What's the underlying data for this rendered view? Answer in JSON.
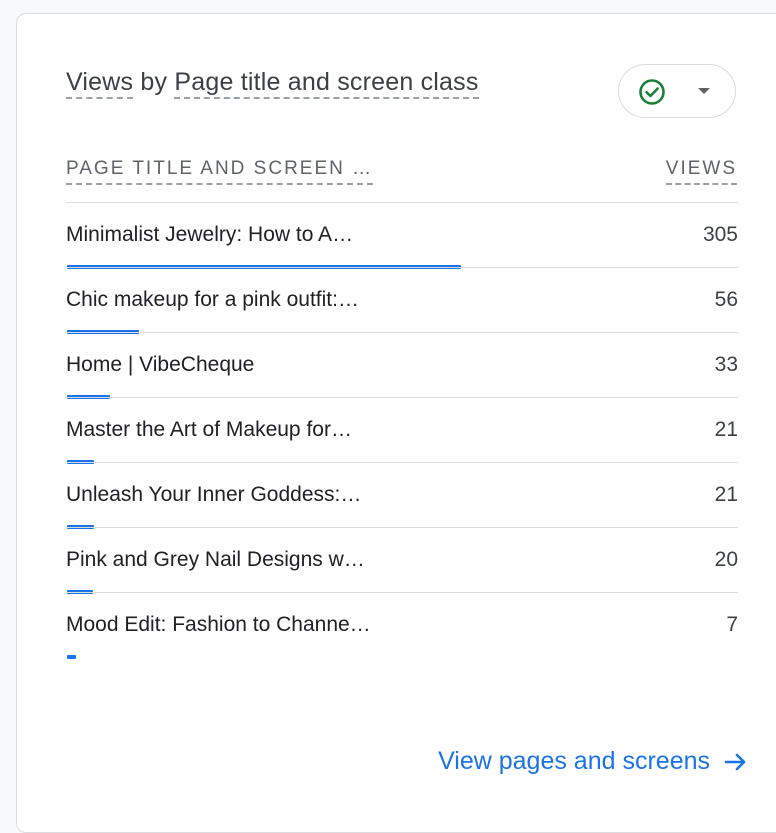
{
  "card": {
    "title_metric": "Views",
    "title_by": " by ",
    "title_dimension": "Page title and screen class",
    "status_icon": "check-circle-icon",
    "dropdown_icon": "caret-down-icon"
  },
  "table": {
    "col_left": "PAGE TITLE AND SCREEN …",
    "col_right": "VIEWS",
    "max_value": 305,
    "rows": [
      {
        "label": "Minimalist Jewelry: How to A…",
        "value": "305",
        "views": 305
      },
      {
        "label": "Chic makeup for a pink outfit:…",
        "value": "56",
        "views": 56
      },
      {
        "label": "Home | VibeCheque",
        "value": "33",
        "views": 33
      },
      {
        "label": "Master the Art of Makeup for…",
        "value": "21",
        "views": 21
      },
      {
        "label": "Unleash Your Inner Goddess:…",
        "value": "21",
        "views": 21
      },
      {
        "label": "Pink and Grey Nail Designs w…",
        "value": "20",
        "views": 20
      },
      {
        "label": "Mood Edit: Fashion to Channe…",
        "value": "7",
        "views": 7
      }
    ]
  },
  "footer": {
    "link_label": "View pages and screens",
    "link_icon": "arrow-right-icon"
  },
  "colors": {
    "accent": "#1a73e8",
    "status_green": "#188038"
  }
}
